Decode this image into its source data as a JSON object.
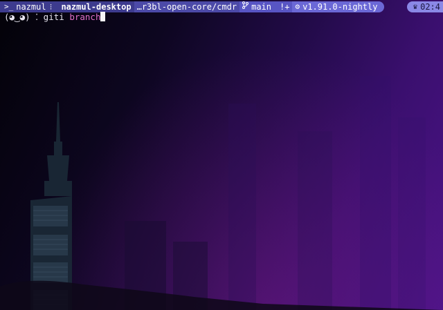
{
  "prompt": {
    "terminal_icon": ">_",
    "user": "nazmul",
    "separator": "⁝",
    "host": "nazmul-desktop",
    "path": "…r3bl-open-core/cmdr",
    "branch_icon": "git-branch-icon",
    "branch": "main",
    "git_status": "!+",
    "runtime_icon": "rust-gear-icon",
    "runtime_version": "v1.91.0-nightly",
    "time_icon": "clock-icon",
    "time": "02:4"
  },
  "command_line": {
    "prompt_symbol": "(◕‿◕) ⁚",
    "command": "giti",
    "argument": "branch"
  },
  "colors": {
    "bar_user": "#3d3b8e",
    "bar_path": "#4c4aa8",
    "bar_git": "#5855c4",
    "bar_runtime": "#6b68d6",
    "bar_time": "#8a88e6",
    "argument": "#e070c8",
    "cursor": "#f5f5f5"
  }
}
